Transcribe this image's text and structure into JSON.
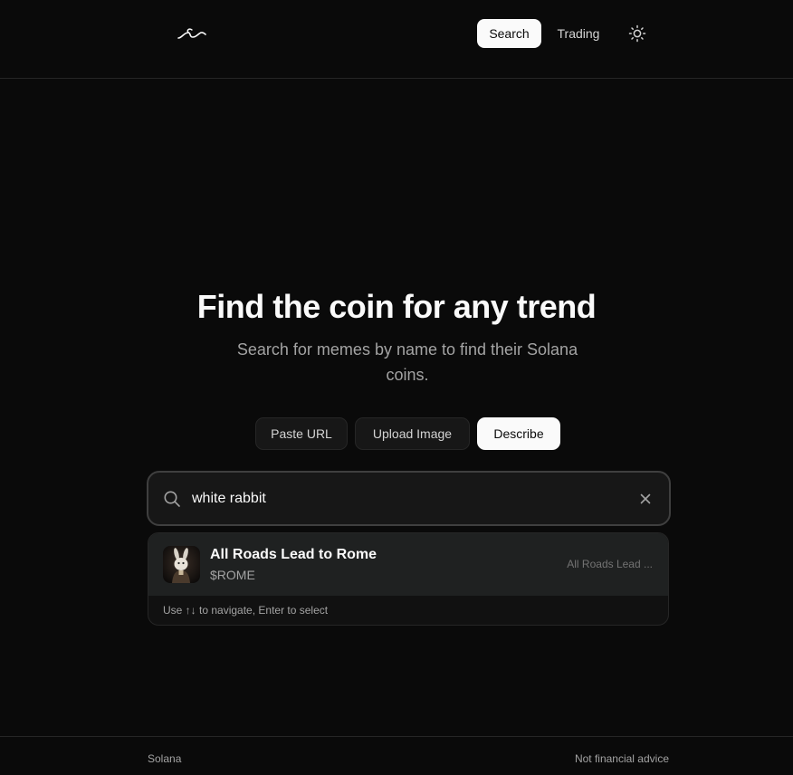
{
  "header": {
    "logo_icon": "wave-logo",
    "nav": {
      "search_label": "Search",
      "trading_label": "Trading"
    },
    "theme_icon": "sun-icon"
  },
  "hero": {
    "title": "Find the coin for any trend",
    "subtitle": "Search for memes by name to find their Solana coins."
  },
  "modes": {
    "paste_url": "Paste URL",
    "upload_image": "Upload Image",
    "describe": "Describe",
    "selected": "Describe"
  },
  "search": {
    "value": "white rabbit",
    "icon": "search-icon",
    "clear_icon": "close-icon"
  },
  "results": {
    "items": [
      {
        "name": "All Roads Lead to Rome",
        "ticker": "$ROME",
        "description": "All Roads Lead ..."
      }
    ],
    "hint": "Use ↑↓ to navigate, Enter to select"
  },
  "footer": {
    "left": "Solana",
    "right": "Not financial advice"
  },
  "colors": {
    "background": "#0a0a0a",
    "accent": "#fafafa",
    "border": "#262626"
  }
}
